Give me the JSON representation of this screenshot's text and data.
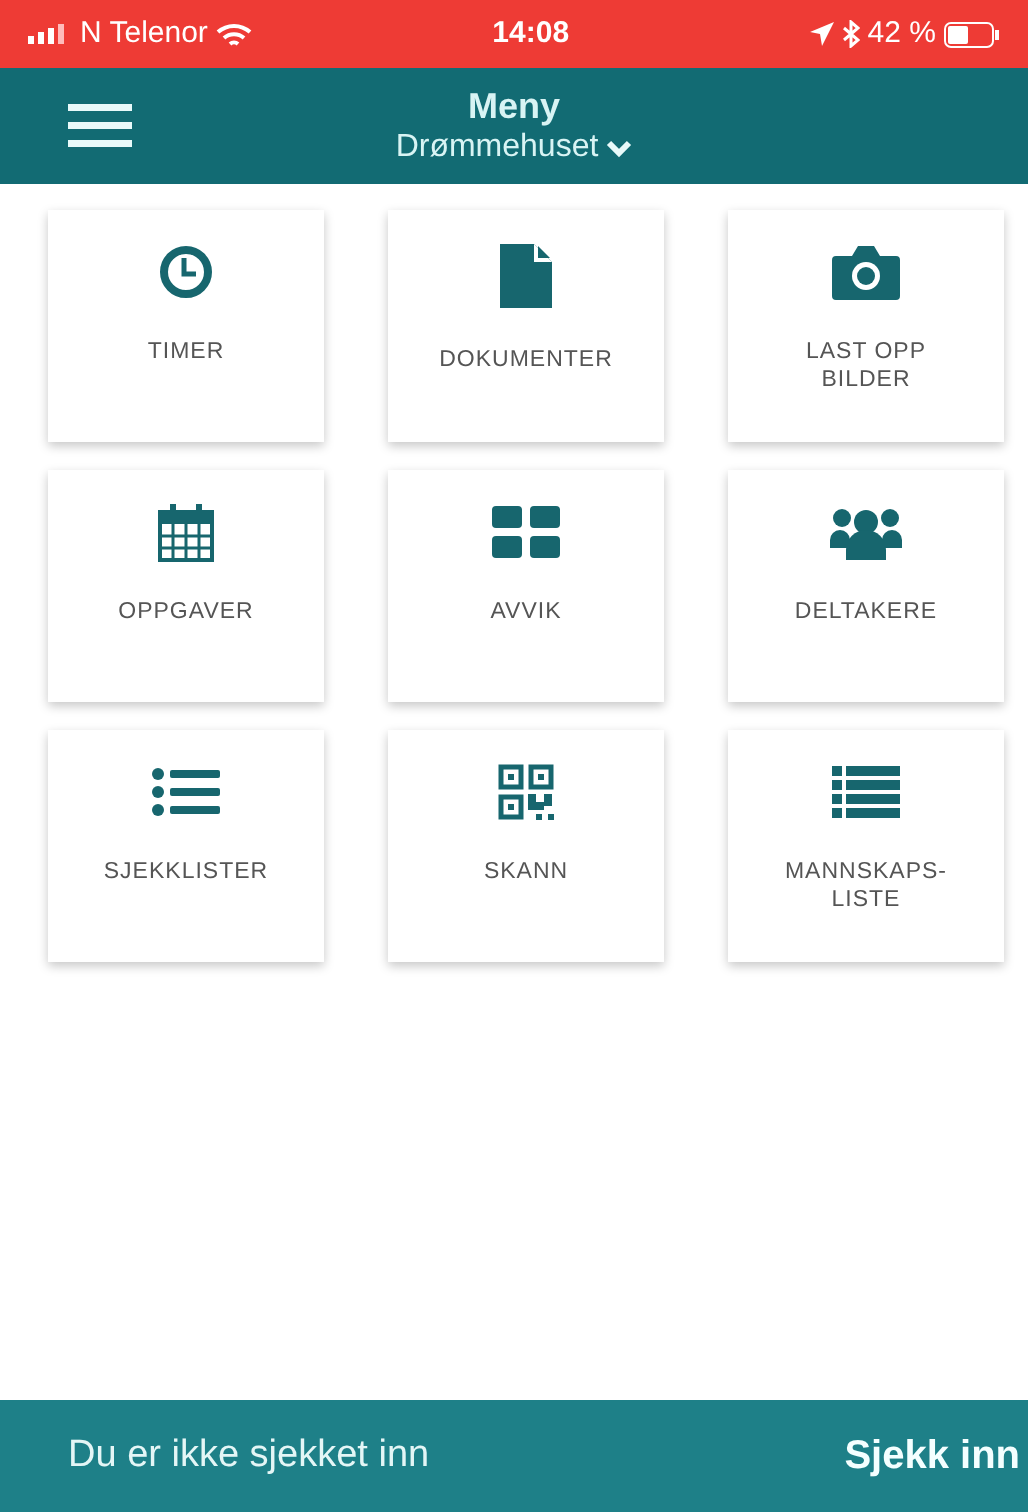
{
  "status_bar": {
    "carrier": "N Telenor",
    "time": "14:08",
    "battery": "42 %"
  },
  "header": {
    "title": "Meny",
    "project": "Drømmehuset"
  },
  "tiles": [
    {
      "label": "TIMER"
    },
    {
      "label": "DOKUMENTER"
    },
    {
      "label": "LAST OPP BILDER"
    },
    {
      "label": "OPPGAVER"
    },
    {
      "label": "AVVIK"
    },
    {
      "label": "DELTAKERE"
    },
    {
      "label": "SJEKKLISTER"
    },
    {
      "label": "SKANN"
    },
    {
      "label": "MANNSKAPS-LISTE"
    }
  ],
  "footer": {
    "status": "Du er ikke sjekket inn",
    "action": "Sjekk inn"
  }
}
